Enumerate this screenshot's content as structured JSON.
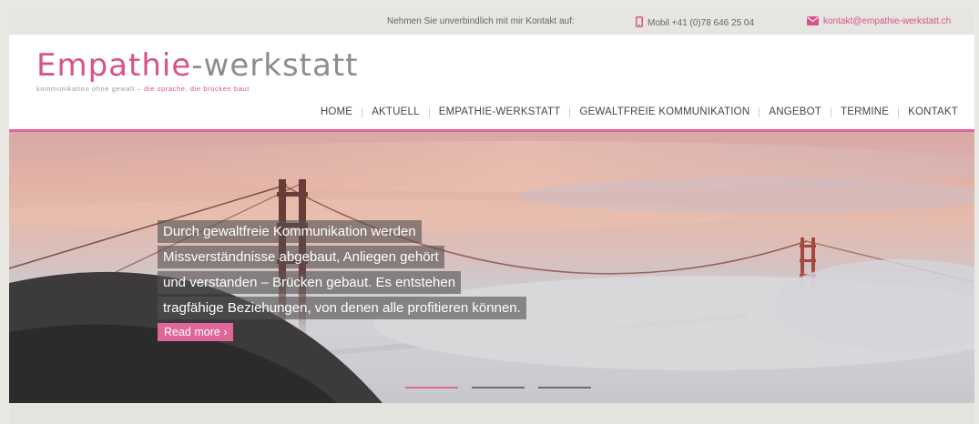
{
  "topbar": {
    "intro": "Nehmen Sie unverbindlich mit mir Kontakt auf:",
    "phone": "Mobil +41 (0)78 646 25 04",
    "email": "kontakt@empathie-werkstatt.ch",
    "phone_icon": "mobile-phone-icon",
    "email_icon": "envelope-icon"
  },
  "logo": {
    "part1": "Empathie",
    "hyphen": "-",
    "part2": "werkstatt",
    "tagline_gray": "kommunikation ohne gewalt –",
    "tagline_pink": "die sprache, die brücken baut"
  },
  "nav": [
    "HOME",
    "AKTUELL",
    "EMPATHIE-WERKSTATT",
    "GEWALTFREIE KOMMUNIKATION",
    "ANGEBOT",
    "TERMINE",
    "KONTAKT"
  ],
  "hero": {
    "lines": [
      "Durch gewaltfreie Kommunikation werden",
      "Missverständnisse abgebaut, Anliegen gehört",
      "und verstanden – Brücken gebaut. Es entstehen",
      "tragfähige Beziehungen, von denen alle profitieren können."
    ],
    "read_more": "Read more ›",
    "slides": 3,
    "active_slide": 1
  },
  "colors": {
    "accent": "#e0679a",
    "logo_gray": "#8a8d91",
    "background": "#e9e8e3"
  }
}
